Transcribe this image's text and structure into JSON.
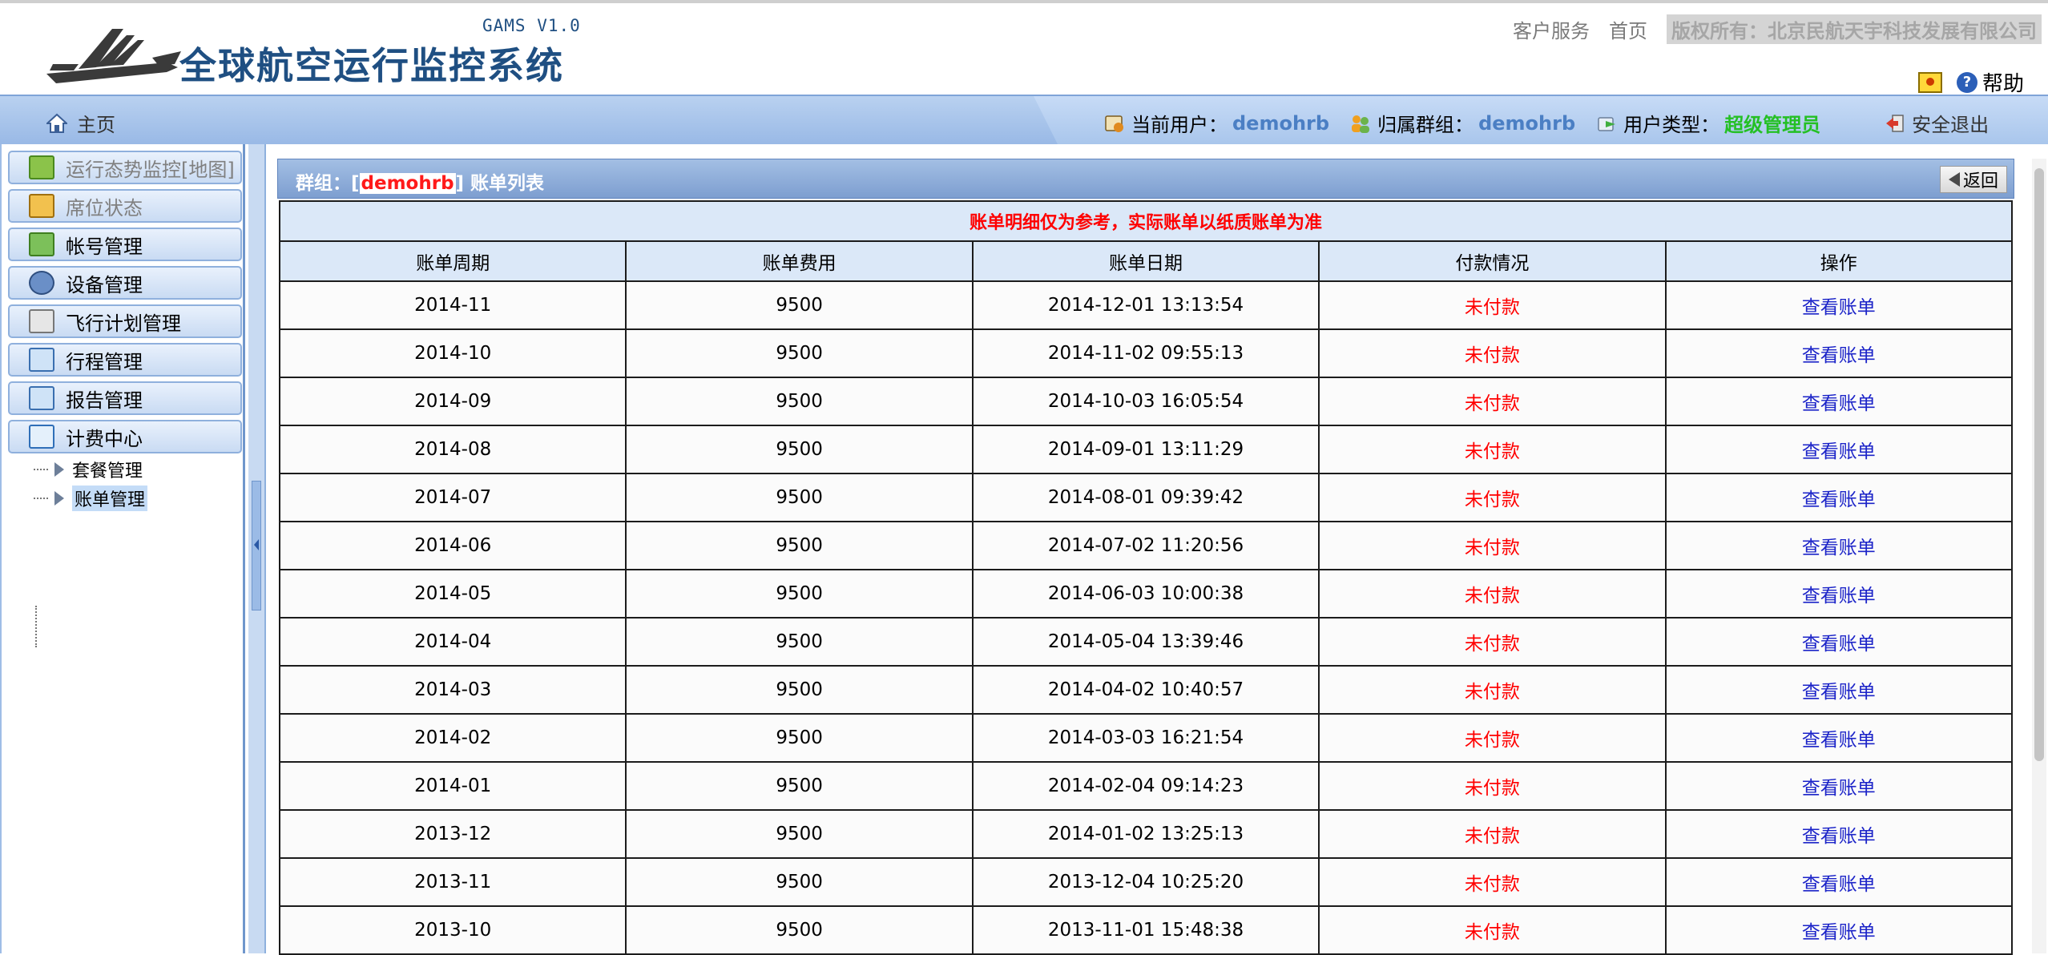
{
  "header": {
    "version": "GAMS V1.0",
    "title": "全球航空运行监控系统",
    "links": [
      "客户服务",
      "首页"
    ],
    "copyright": "版权所有：北京民航天宇科技发展有限公司",
    "help_label": "帮助"
  },
  "navbar": {
    "home_label": "主页",
    "current_user_label": "当前用户：",
    "current_user": "demohrb",
    "group_label": "归属群组：",
    "group": "demohrb",
    "user_type_label": "用户类型：",
    "user_type": "超级管理员",
    "logout_label": "安全退出"
  },
  "sidebar": {
    "items": [
      {
        "label": "运行态势监控[地图]",
        "icon": "monitor-icon"
      },
      {
        "label": "席位状态",
        "icon": "seat-icon"
      },
      {
        "label": "帐号管理",
        "icon": "account-icon"
      },
      {
        "label": "设备管理",
        "icon": "device-icon"
      },
      {
        "label": "飞行计划管理",
        "icon": "flight-plan-icon"
      },
      {
        "label": "行程管理",
        "icon": "itinerary-icon"
      },
      {
        "label": "报告管理",
        "icon": "report-icon"
      },
      {
        "label": "计费中心",
        "icon": "billing-icon"
      }
    ],
    "sub_items": [
      {
        "label": "套餐管理"
      },
      {
        "label": "账单管理"
      }
    ]
  },
  "panel": {
    "prefix": "群组：[",
    "group": "demohrb",
    "suffix": "] 账单列表",
    "back_label": "返回"
  },
  "table": {
    "notice": "账单明细仅为参考，实际账单以纸质账单为准",
    "columns": [
      "账单周期",
      "账单费用",
      "账单日期",
      "付款情况",
      "操作"
    ],
    "rows": [
      {
        "period": "2014-11",
        "fee": "9500",
        "date": "2014-12-01 13:13:54",
        "status": "未付款",
        "action": "查看账单"
      },
      {
        "period": "2014-10",
        "fee": "9500",
        "date": "2014-11-02 09:55:13",
        "status": "未付款",
        "action": "查看账单"
      },
      {
        "period": "2014-09",
        "fee": "9500",
        "date": "2014-10-03 16:05:54",
        "status": "未付款",
        "action": "查看账单"
      },
      {
        "period": "2014-08",
        "fee": "9500",
        "date": "2014-09-01 13:11:29",
        "status": "未付款",
        "action": "查看账单"
      },
      {
        "period": "2014-07",
        "fee": "9500",
        "date": "2014-08-01 09:39:42",
        "status": "未付款",
        "action": "查看账单"
      },
      {
        "period": "2014-06",
        "fee": "9500",
        "date": "2014-07-02 11:20:56",
        "status": "未付款",
        "action": "查看账单"
      },
      {
        "period": "2014-05",
        "fee": "9500",
        "date": "2014-06-03 10:00:38",
        "status": "未付款",
        "action": "查看账单"
      },
      {
        "period": "2014-04",
        "fee": "9500",
        "date": "2014-05-04 13:39:46",
        "status": "未付款",
        "action": "查看账单"
      },
      {
        "period": "2014-03",
        "fee": "9500",
        "date": "2014-04-02 10:40:57",
        "status": "未付款",
        "action": "查看账单"
      },
      {
        "period": "2014-02",
        "fee": "9500",
        "date": "2014-03-03 16:21:54",
        "status": "未付款",
        "action": "查看账单"
      },
      {
        "period": "2014-01",
        "fee": "9500",
        "date": "2014-02-04 09:14:23",
        "status": "未付款",
        "action": "查看账单"
      },
      {
        "period": "2013-12",
        "fee": "9500",
        "date": "2014-01-02 13:25:13",
        "status": "未付款",
        "action": "查看账单"
      },
      {
        "period": "2013-11",
        "fee": "9500",
        "date": "2013-12-04 10:25:20",
        "status": "未付款",
        "action": "查看账单"
      },
      {
        "period": "2013-10",
        "fee": "9500",
        "date": "2013-11-01 15:48:38",
        "status": "未付款",
        "action": "查看账单"
      }
    ]
  },
  "colors": {
    "brand": "#1f4f82",
    "nav_bg": "#a9c6ec",
    "value_blue": "#4b7fc4",
    "admin_green": "#24c024",
    "unpaid_red": "#ff0000",
    "link_blue": "#1b23c8"
  }
}
